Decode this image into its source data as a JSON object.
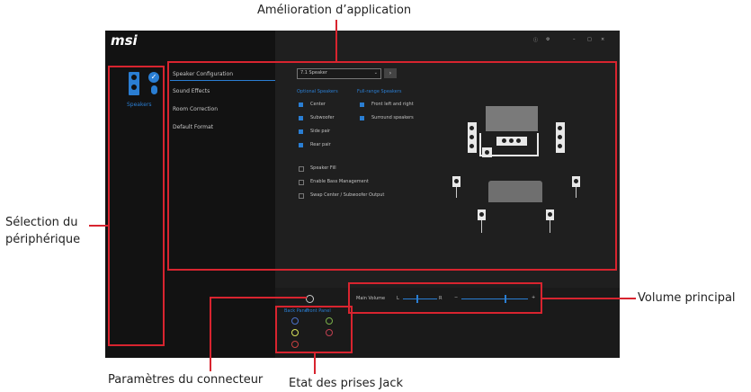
{
  "callouts": {
    "top": "Amélioration d’application",
    "left_line1": "Sélection du",
    "left_line2": "périphérique",
    "right": "Volume principal",
    "bottom_left": "Paramètres du connecteur",
    "bottom_right": "Etat des prises Jack"
  },
  "app": {
    "logo": "msi",
    "device_label": "Speakers",
    "tabs": [
      "Speaker Configuration",
      "Sound Effects",
      "Room Correction",
      "Default Format"
    ],
    "config_select": "7.1 Speaker",
    "optional_title": "Optional Speakers",
    "fullrange_title": "Full-range Speakers",
    "optional": [
      {
        "label": "Center",
        "checked": true
      },
      {
        "label": "Subwoofer",
        "checked": true
      },
      {
        "label": "Side pair",
        "checked": true
      },
      {
        "label": "Rear pair",
        "checked": true
      }
    ],
    "fullrange": [
      {
        "label": "Front left and right",
        "checked": true
      },
      {
        "label": "Surround speakers",
        "checked": true
      }
    ],
    "extra": [
      {
        "label": "Speaker Fill",
        "checked": false
      },
      {
        "label": "Enable Bass Management",
        "checked": false
      },
      {
        "label": "Swap Center / Subwoofer Output",
        "checked": false
      }
    ],
    "volume_label": "Main Volume",
    "volume_left": "L",
    "volume_right": "R",
    "volume_minus": "−",
    "volume_plus": "+",
    "back_panel": "Back Panel",
    "front_panel": "Front Panel",
    "colors": {
      "accent": "#2a7ed3",
      "callout": "#d8242f"
    }
  }
}
